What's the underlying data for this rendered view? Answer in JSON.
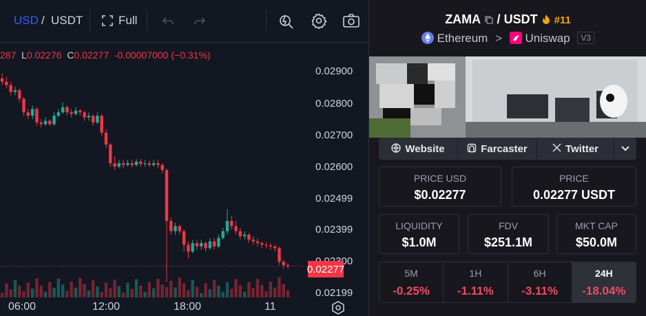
{
  "toolbar": {
    "quote_primary": "USD",
    "separator": "/",
    "quote_secondary": "USDT",
    "fullscreen_label": "Full"
  },
  "ohlc": {
    "open_partial": "287",
    "low_label": "L",
    "low_value": "0.02276",
    "close_label": "C",
    "close_value": "0.02277",
    "change": "-0.00007000 (−0.31%)"
  },
  "price_axis": {
    "labels": [
      "0.02900",
      "0.02800",
      "0.02700",
      "0.02600",
      "0.02499",
      "0.02399",
      "0.02300",
      "0.02199"
    ],
    "current": "0.02277"
  },
  "time_axis": {
    "labels": [
      "06:00",
      "12:00",
      "18:00",
      "11"
    ]
  },
  "chart_data": {
    "type": "candlestick",
    "price_range": [
      0.02185,
      0.02935
    ],
    "current_price": 0.02277,
    "candles": [
      [
        0.0283,
        0.0282,
        0.02845,
        0.0281
      ],
      [
        0.0282,
        0.0281,
        0.02835,
        0.028
      ],
      [
        0.0281,
        0.0279,
        0.0282,
        0.0278
      ],
      [
        0.0279,
        0.02795,
        0.02805,
        0.0278
      ],
      [
        0.02795,
        0.0277,
        0.028,
        0.0276
      ],
      [
        0.0277,
        0.0273,
        0.02775,
        0.0272
      ],
      [
        0.0273,
        0.0272,
        0.0274,
        0.0271
      ],
      [
        0.0272,
        0.0274,
        0.0275,
        0.0271
      ],
      [
        0.0274,
        0.027,
        0.02745,
        0.0269
      ],
      [
        0.027,
        0.02695,
        0.0271,
        0.02685
      ],
      [
        0.02695,
        0.02705,
        0.02715,
        0.0269
      ],
      [
        0.02705,
        0.02695,
        0.0271,
        0.0269
      ],
      [
        0.02695,
        0.0272,
        0.0273,
        0.0269
      ],
      [
        0.0272,
        0.0273,
        0.0274,
        0.02715
      ],
      [
        0.0273,
        0.02745,
        0.0276,
        0.02725
      ],
      [
        0.02745,
        0.0273,
        0.0275,
        0.0272
      ],
      [
        0.0273,
        0.02725,
        0.0274,
        0.02715
      ],
      [
        0.02725,
        0.02735,
        0.02745,
        0.0272
      ],
      [
        0.02735,
        0.0273,
        0.0274,
        0.0272
      ],
      [
        0.0273,
        0.02715,
        0.02735,
        0.02705
      ],
      [
        0.02715,
        0.0272,
        0.0273,
        0.02705
      ],
      [
        0.0272,
        0.027,
        0.02725,
        0.0269
      ],
      [
        0.027,
        0.0272,
        0.0273,
        0.02695
      ],
      [
        0.0272,
        0.0267,
        0.02725,
        0.0266
      ],
      [
        0.0267,
        0.02635,
        0.0268,
        0.02625
      ],
      [
        0.02635,
        0.0258,
        0.0264,
        0.0257
      ],
      [
        0.0258,
        0.0257,
        0.026,
        0.0256
      ],
      [
        0.0257,
        0.0258,
        0.0259,
        0.02565
      ],
      [
        0.0258,
        0.02575,
        0.0259,
        0.02565
      ],
      [
        0.02575,
        0.0258,
        0.0259,
        0.0257
      ],
      [
        0.0258,
        0.02575,
        0.0259,
        0.02568
      ],
      [
        0.02575,
        0.02585,
        0.02592,
        0.0257
      ],
      [
        0.02585,
        0.02578,
        0.02592,
        0.0257
      ],
      [
        0.02578,
        0.0258,
        0.0259,
        0.0257
      ],
      [
        0.0258,
        0.02575,
        0.02588,
        0.0257
      ],
      [
        0.02575,
        0.0258,
        0.0259,
        0.0257
      ],
      [
        0.0258,
        0.02575,
        0.0259,
        0.02565
      ],
      [
        0.02575,
        0.0256,
        0.0258,
        0.0255
      ],
      [
        0.0256,
        0.0241,
        0.02565,
        0.0223
      ],
      [
        0.0241,
        0.0238,
        0.0242,
        0.0237
      ],
      [
        0.0238,
        0.02395,
        0.02405,
        0.0237
      ],
      [
        0.02395,
        0.0238,
        0.024,
        0.0237
      ],
      [
        0.0238,
        0.0234,
        0.02385,
        0.0232
      ],
      [
        0.0234,
        0.0232,
        0.0235,
        0.023
      ],
      [
        0.0232,
        0.02345,
        0.02355,
        0.02315
      ],
      [
        0.02345,
        0.02335,
        0.02355,
        0.02325
      ],
      [
        0.02335,
        0.02345,
        0.02355,
        0.02325
      ],
      [
        0.02345,
        0.0233,
        0.0235,
        0.0232
      ],
      [
        0.0233,
        0.0235,
        0.0236,
        0.02325
      ],
      [
        0.0235,
        0.02335,
        0.0236,
        0.02325
      ],
      [
        0.02335,
        0.0236,
        0.0237,
        0.0233
      ],
      [
        0.0236,
        0.0238,
        0.0239,
        0.02355
      ],
      [
        0.0238,
        0.0241,
        0.02445,
        0.0237
      ],
      [
        0.0241,
        0.02395,
        0.02425,
        0.02385
      ],
      [
        0.02395,
        0.0238,
        0.0241,
        0.0237
      ],
      [
        0.0238,
        0.02365,
        0.0239,
        0.02355
      ],
      [
        0.02365,
        0.0237,
        0.0238,
        0.02355
      ],
      [
        0.0237,
        0.02355,
        0.02375,
        0.02345
      ],
      [
        0.02355,
        0.0235,
        0.02365,
        0.0234
      ],
      [
        0.0235,
        0.02345,
        0.0236,
        0.02335
      ],
      [
        0.02345,
        0.0234,
        0.0235,
        0.0233
      ],
      [
        0.0234,
        0.02338,
        0.02348,
        0.0233
      ],
      [
        0.02338,
        0.02335,
        0.02345,
        0.02325
      ],
      [
        0.02335,
        0.0233,
        0.0234,
        0.0232
      ],
      [
        0.0233,
        0.0229,
        0.02335,
        0.0228
      ],
      [
        0.0229,
        0.0228,
        0.02295,
        0.0227
      ],
      [
        0.0228,
        0.02277,
        0.02285,
        0.0227
      ]
    ]
  },
  "pair": {
    "base": "ZAMA",
    "slash": "/",
    "quote": "USDT",
    "rank": "#11",
    "chain": "Ethereum",
    "chevron": ">",
    "dex": "Uniswap",
    "dex_version": "V3"
  },
  "links": {
    "website": "Website",
    "farcaster": "Farcaster",
    "twitter": "Twitter"
  },
  "stats": {
    "price_usd_label": "PRICE USD",
    "price_usd_value": "$0.02277",
    "price_label": "PRICE",
    "price_value": "0.02277 USDT",
    "liquidity_label": "LIQUIDITY",
    "liquidity_value": "$1.0M",
    "fdv_label": "FDV",
    "fdv_value": "$251.1M",
    "mktcap_label": "MKT CAP",
    "mktcap_value": "$50.0M"
  },
  "timeframes": [
    {
      "label": "5M",
      "value": "-0.25%"
    },
    {
      "label": "1H",
      "value": "-1.11%"
    },
    {
      "label": "6H",
      "value": "-3.11%"
    },
    {
      "label": "24H",
      "value": "-18.04%"
    }
  ],
  "colors": {
    "up": "#22ab94",
    "down": "#f23645",
    "accent_blue": "#2962ff",
    "rank_orange": "#f7a600"
  }
}
